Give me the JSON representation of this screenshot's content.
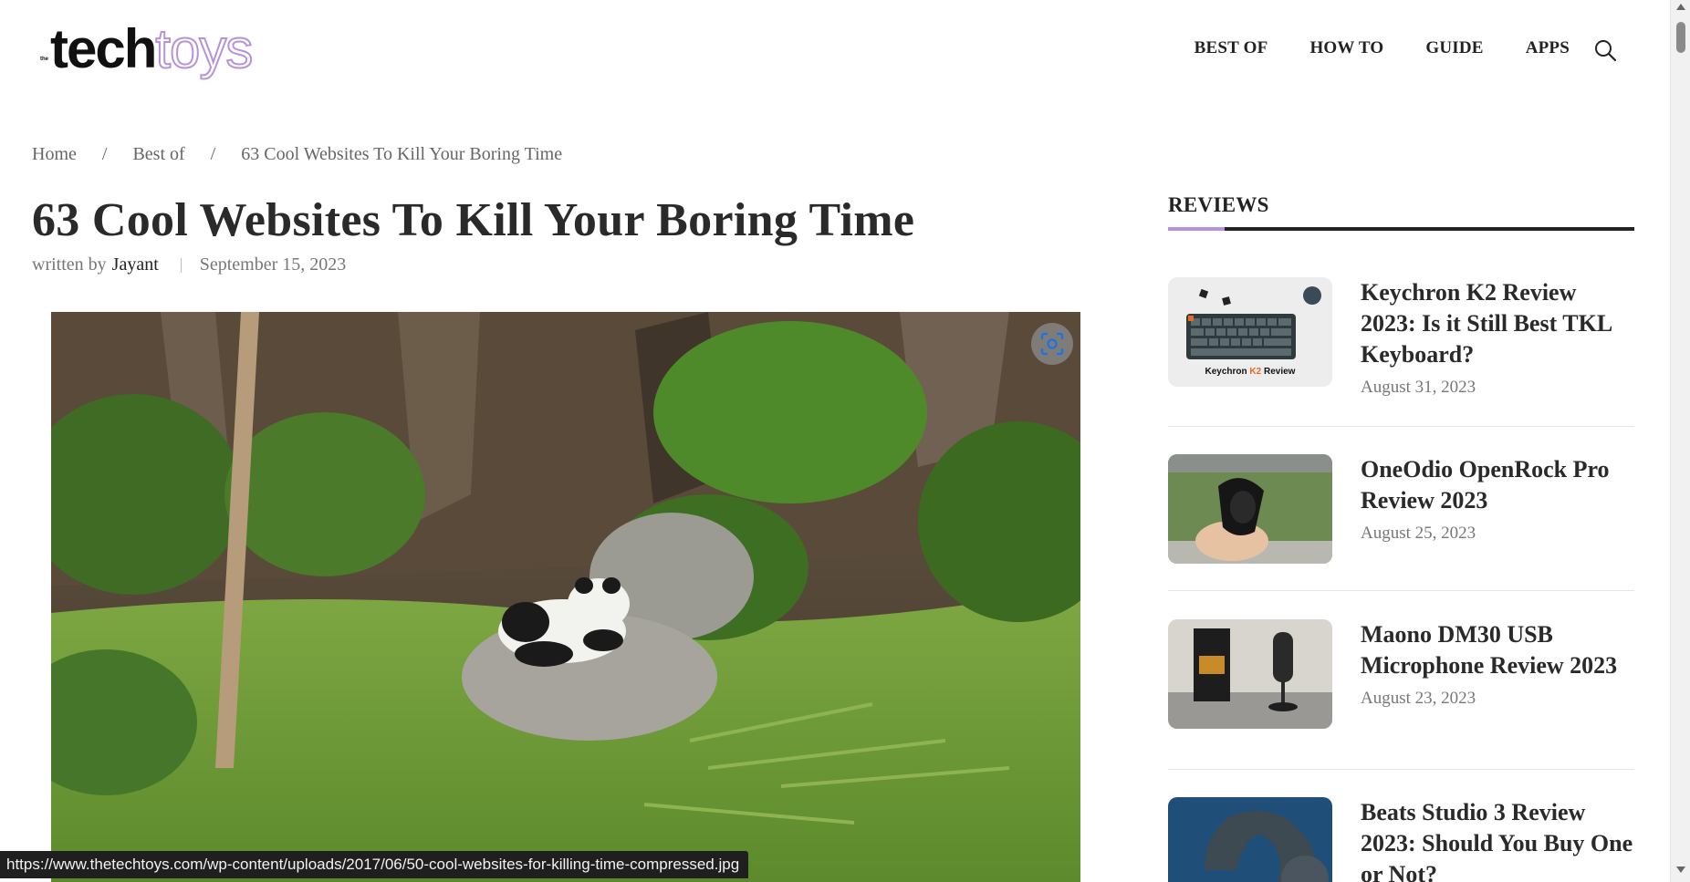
{
  "logo": {
    "small": "the",
    "part1": "tech",
    "part2": "toys"
  },
  "nav": {
    "items": [
      {
        "label": "BEST OF"
      },
      {
        "label": "HOW TO"
      },
      {
        "label": "GUIDE"
      },
      {
        "label": "APPS"
      }
    ],
    "search_icon": "search-icon"
  },
  "breadcrumb": {
    "home": "Home",
    "category": "Best of",
    "current": "63 Cool Websites To Kill Your Boring Time",
    "separator": "/"
  },
  "article": {
    "title": "63 Cool Websites To Kill Your Boring Time",
    "written_by": "written by",
    "author": "Jayant",
    "date": "September 15, 2023",
    "lens_icon": "visual-search-icon"
  },
  "sidebar": {
    "heading": "REVIEWS",
    "reviews": [
      {
        "title": "Keychron K2 Review 2023: Is it Still Best TKL Keyboard?",
        "date": "August 31, 2023",
        "thumb_caption_a": "Keychron ",
        "thumb_caption_b": "K2",
        "thumb_caption_c": " Review"
      },
      {
        "title": "OneOdio OpenRock Pro Review 2023",
        "date": "August 25, 2023"
      },
      {
        "title": "Maono DM30 USB Microphone Review 2023",
        "date": "August 23, 2023"
      },
      {
        "title": "Beats Studio 3 Review 2023: Should You Buy One or Not?",
        "date": ""
      }
    ]
  },
  "status_bar": {
    "url": "https://www.thetechtoys.com/wp-content/uploads/2017/06/50-cool-websites-for-killing-time-compressed.jpg"
  },
  "colors": {
    "accent": "#b493dc",
    "text_dark": "#2a2a2a",
    "text_muted": "#777777"
  }
}
